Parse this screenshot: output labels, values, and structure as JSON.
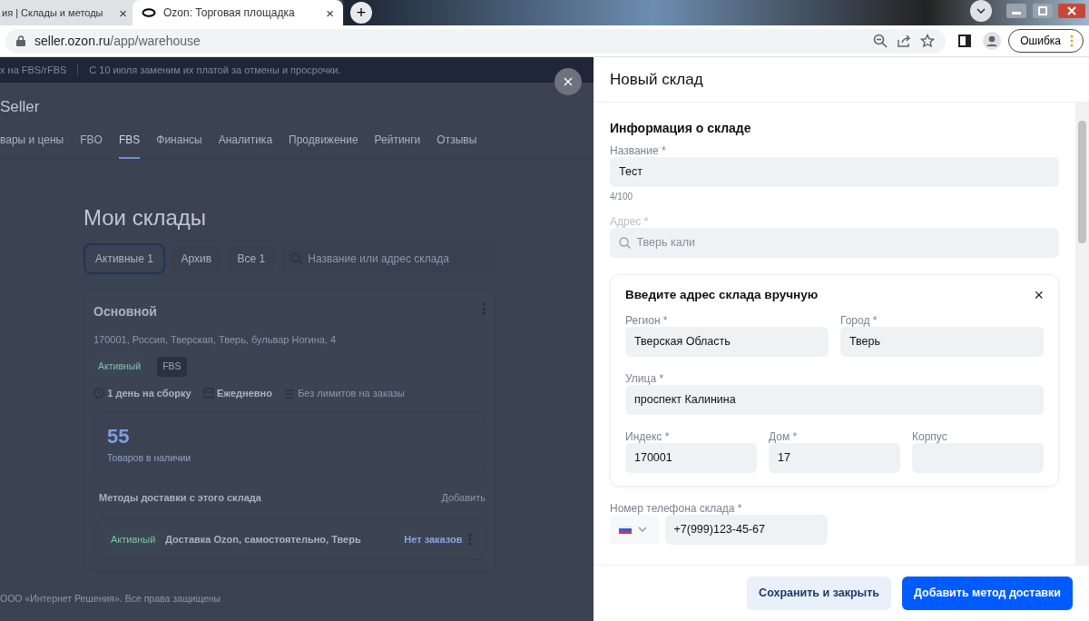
{
  "browser": {
    "tabs": [
      {
        "title": "ия | Склады и методы",
        "selected": false,
        "close": "×"
      },
      {
        "title": "Ozon: Торговая площадка",
        "selected": true,
        "close": "×"
      }
    ],
    "new_tab": "+",
    "url_host": "seller.ozon.ru",
    "url_path": "/app/warehouse",
    "profile_button": "Ошибка"
  },
  "background": {
    "banner": {
      "left": "х на FBS/rFBS",
      "right": "С 10 июля заменим их платой за отмены и просрочки."
    },
    "logo": "Seller",
    "nav": [
      {
        "label": "вары и цены",
        "selected": false
      },
      {
        "label": "FBO",
        "selected": false
      },
      {
        "label": "FBS",
        "selected": true
      },
      {
        "label": "Финансы",
        "selected": false
      },
      {
        "label": "Аналитика",
        "selected": false
      },
      {
        "label": "Продвижение",
        "selected": false
      },
      {
        "label": "Рейтинги",
        "selected": false
      },
      {
        "label": "Отзывы",
        "selected": false
      }
    ],
    "heading": "Мои склады",
    "filters": [
      {
        "label": "Активные",
        "count": "1",
        "selected": true
      },
      {
        "label": "Архив",
        "selected": false
      },
      {
        "label": "Все",
        "count": "1",
        "selected": false
      }
    ],
    "search": {
      "placeholder": "Название или адрес склада"
    },
    "warehouse": {
      "name": "Основной",
      "address": "170001, Россия, Тверская, Тверь, бульвар Ногина, 4",
      "status": "Активный",
      "scheme": "FBS",
      "facts": [
        "1 день на сборку",
        "Ежедневно",
        "Без лимитов на заказы"
      ],
      "stock_count": "55",
      "stock_label": "Товаров в наличии",
      "methods_title": "Методы доставки с этого склада",
      "add_link": "Добавить",
      "method": {
        "status": "Активный",
        "name": "Доставка Ozon, самостоятельно, Тверь",
        "orders": "Нет заказов"
      }
    },
    "footer": "ООО «Интернет Решения». Все права защищены"
  },
  "drawer": {
    "title": "Новый склад",
    "section": "Информация о складе",
    "name_field": {
      "label": "Название *",
      "value": "Тест",
      "counter": "4/100"
    },
    "address_field": {
      "label": "Адрес *",
      "value": "Тверь кали",
      "disabled": true
    },
    "manual": {
      "title": "Введите адрес склада вручную",
      "close": "×",
      "rows": [
        [
          {
            "label": "Регион *",
            "value": "Тверская Область"
          },
          {
            "label": "Город *",
            "value": "Тверь"
          }
        ],
        [
          {
            "label": "Улица *",
            "value": "проспект Калинина"
          }
        ],
        [
          {
            "label": "Индекс *",
            "value": "170001"
          },
          {
            "label": "Дом *",
            "value": "17"
          },
          {
            "label": "Корпус"
          }
        ]
      ]
    },
    "phone": {
      "label": "Номер телефона склада *",
      "value": "+7(999)123-45-67"
    },
    "buttons": [
      {
        "label": "Сохранить и закрыть",
        "kind": "secondary"
      },
      {
        "label": "Добавить метод доставки",
        "kind": "primary"
      }
    ]
  }
}
